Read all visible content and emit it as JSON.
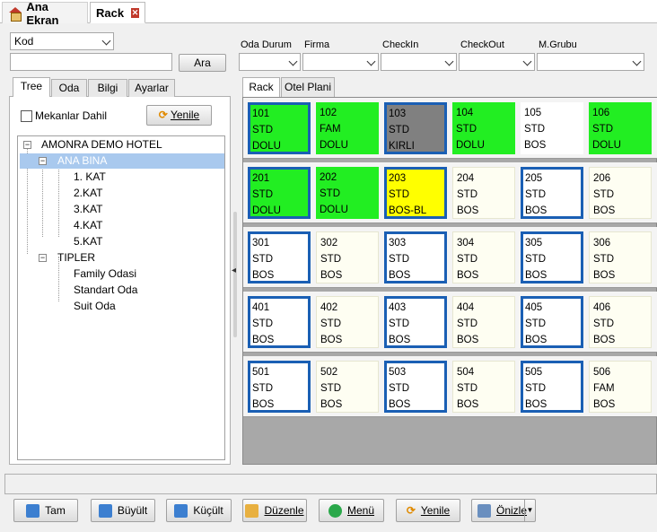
{
  "tabs": [
    {
      "label": "Ana Ekran",
      "icon": "home-icon"
    },
    {
      "label": "Rack",
      "icon": "close-icon"
    }
  ],
  "search": {
    "field_select": "Kod",
    "input_value": "",
    "button_label": "Ara"
  },
  "filters": {
    "oda_durum": "Oda Durum",
    "firma": "Firma",
    "checkin": "CheckIn",
    "checkout": "CheckOut",
    "mgrubu": "M.Grubu"
  },
  "left_tabs": [
    "Tree",
    "Oda",
    "Bilgi",
    "Ayarlar"
  ],
  "mekanlar_label": "Mekanlar Dahil",
  "yenile_label": "Yenile",
  "tree": {
    "root": "AMONRA DEMO HOTEL",
    "bina": "ANA BINA",
    "katlar": [
      "1. KAT",
      "2.KAT",
      "3.KAT",
      "4.KAT",
      "5.KAT"
    ],
    "tipler": "TIPLER",
    "tip_items": [
      "Family Odasi",
      "Standart Oda",
      "Suit Oda"
    ]
  },
  "right_tabs": [
    "Rack",
    "Otel Plani"
  ],
  "rooms": [
    [
      {
        "no": "101",
        "type": "STD",
        "status": "DOLU",
        "style": "green-blue"
      },
      {
        "no": "102",
        "type": "FAM",
        "status": "DOLU",
        "style": "green"
      },
      {
        "no": "103",
        "type": "STD",
        "status": "KIRLI",
        "style": "gray-blue"
      },
      {
        "no": "104",
        "type": "STD",
        "status": "DOLU",
        "style": "green"
      },
      {
        "no": "105",
        "type": "STD",
        "status": "BOS",
        "style": "white"
      },
      {
        "no": "106",
        "type": "STD",
        "status": "DOLU",
        "style": "green"
      }
    ],
    [
      {
        "no": "201",
        "type": "STD",
        "status": "DOLU",
        "style": "green-blue"
      },
      {
        "no": "202",
        "type": "STD",
        "status": "DOLU",
        "style": "green"
      },
      {
        "no": "203",
        "type": "STD",
        "status": "BOS-BL",
        "style": "yellow-blue"
      },
      {
        "no": "204",
        "type": "STD",
        "status": "BOS",
        "style": "cream"
      },
      {
        "no": "205",
        "type": "STD",
        "status": "BOS",
        "style": "blue"
      },
      {
        "no": "206",
        "type": "STD",
        "status": "BOS",
        "style": "cream"
      }
    ],
    [
      {
        "no": "301",
        "type": "STD",
        "status": "BOS",
        "style": "blue"
      },
      {
        "no": "302",
        "type": "STD",
        "status": "BOS",
        "style": "cream"
      },
      {
        "no": "303",
        "type": "STD",
        "status": "BOS",
        "style": "blue"
      },
      {
        "no": "304",
        "type": "STD",
        "status": "BOS",
        "style": "cream"
      },
      {
        "no": "305",
        "type": "STD",
        "status": "BOS",
        "style": "blue"
      },
      {
        "no": "306",
        "type": "STD",
        "status": "BOS",
        "style": "cream"
      }
    ],
    [
      {
        "no": "401",
        "type": "STD",
        "status": "BOS",
        "style": "blue"
      },
      {
        "no": "402",
        "type": "STD",
        "status": "BOS",
        "style": "cream"
      },
      {
        "no": "403",
        "type": "STD",
        "status": "BOS",
        "style": "blue"
      },
      {
        "no": "404",
        "type": "STD",
        "status": "BOS",
        "style": "cream"
      },
      {
        "no": "405",
        "type": "STD",
        "status": "BOS",
        "style": "blue"
      },
      {
        "no": "406",
        "type": "STD",
        "status": "BOS",
        "style": "cream"
      }
    ],
    [
      {
        "no": "501",
        "type": "STD",
        "status": "BOS",
        "style": "blue"
      },
      {
        "no": "502",
        "type": "STD",
        "status": "BOS",
        "style": "cream"
      },
      {
        "no": "503",
        "type": "STD",
        "status": "BOS",
        "style": "blue"
      },
      {
        "no": "504",
        "type": "STD",
        "status": "BOS",
        "style": "cream"
      },
      {
        "no": "505",
        "type": "STD",
        "status": "BOS",
        "style": "blue"
      },
      {
        "no": "506",
        "type": "FAM",
        "status": "BOS",
        "style": "cream"
      }
    ]
  ],
  "bottom_buttons": [
    {
      "label": "Tam",
      "icon": "search-icon"
    },
    {
      "label": "Büyült",
      "icon": "zoom-in-icon"
    },
    {
      "label": "Küçült",
      "icon": "zoom-out-icon"
    },
    {
      "label": "Düzenle",
      "icon": "edit-icon"
    },
    {
      "label": "Menü",
      "icon": "menu-icon"
    },
    {
      "label": "Yenile",
      "icon": "refresh-icon"
    },
    {
      "label": "Önizle",
      "icon": "preview-icon"
    }
  ],
  "colors": {
    "dolu": "#22ee22",
    "kirli": "#808080",
    "bos_bl": "#ffff00",
    "highlight_border": "#1a5fb4",
    "tree_selection": "#a9c9ee"
  }
}
